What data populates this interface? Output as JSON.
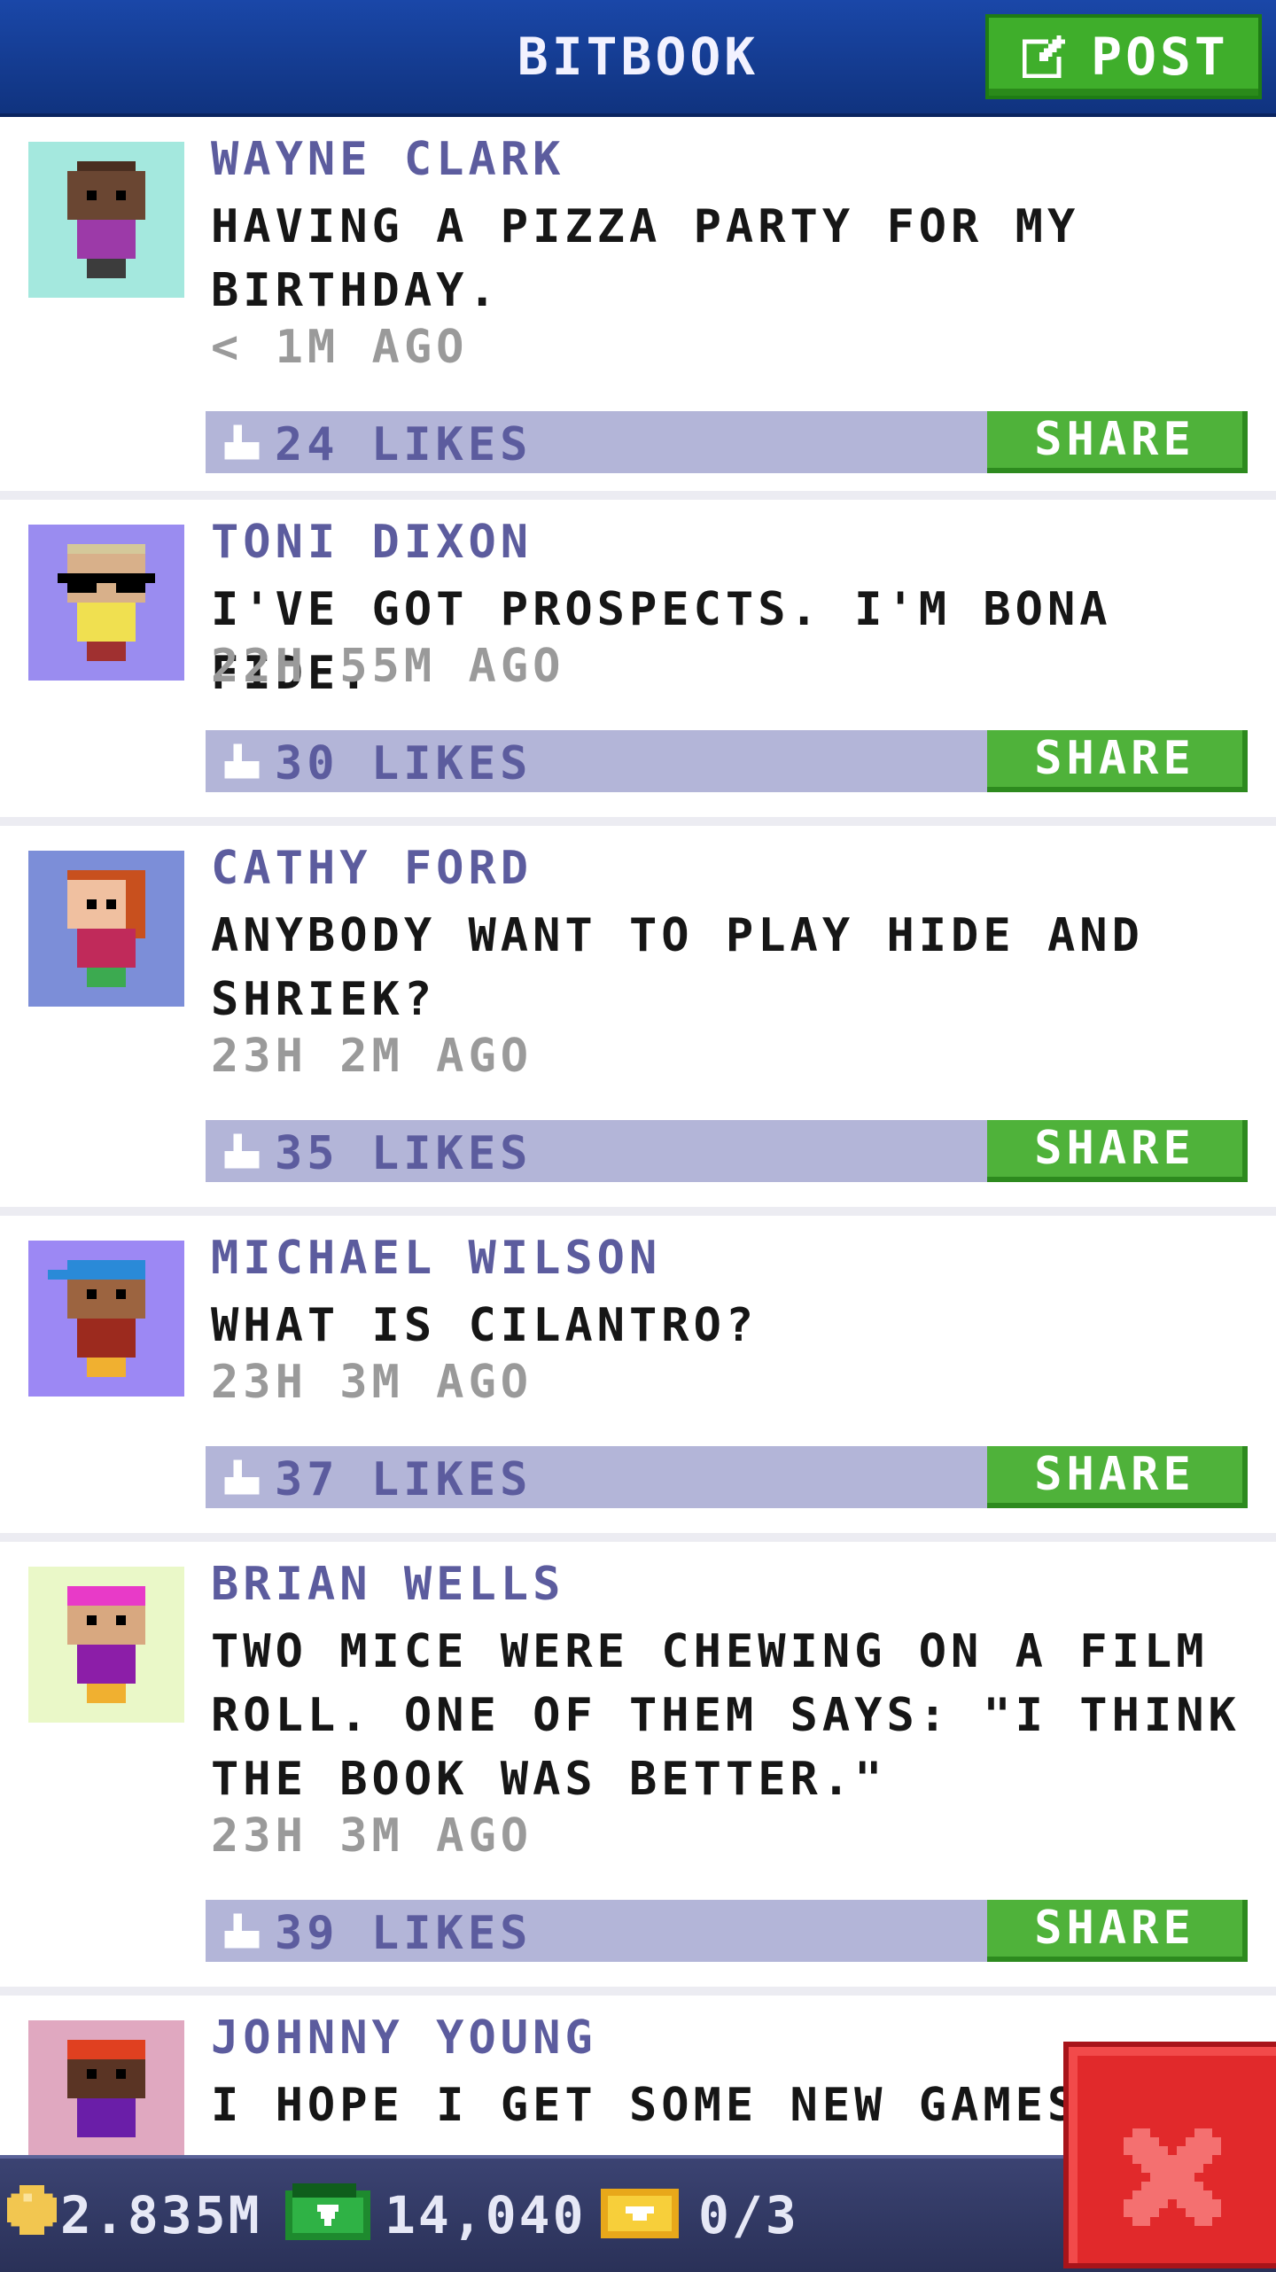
{
  "header": {
    "title": "BITBOOK",
    "post_label": "POST",
    "post_icon": "edit-icon",
    "bar_color": "#10337f",
    "button_color": "#3fae2b"
  },
  "posts": [
    {
      "author": "WAYNE CLARK",
      "message": "HAVING A PIZZA PARTY FOR MY BIRTHDAY.",
      "time": "< 1M AGO",
      "likes": "24 LIKES",
      "share_label": "SHARE",
      "avatar_bg": "#a4e8de",
      "avatar_skin": "#6a4632",
      "avatar_hair": "#4a2e20",
      "avatar_shirt": "#9c3aa8"
    },
    {
      "author": "TONI DIXON",
      "message": "I'VE GOT PROSPECTS. I'M BONA FIDE.",
      "time": "22H 55M AGO",
      "likes": "30 LIKES",
      "share_label": "SHARE",
      "avatar_bg": "#9a8cf0",
      "avatar_skin": "#d8b08a",
      "avatar_hair": "#d4c89a",
      "avatar_shirt": "#f0e050"
    },
    {
      "author": "CATHY FORD",
      "message": "ANYBODY WANT TO PLAY HIDE AND SHRIEK?",
      "time": "23H 2M AGO",
      "likes": "35 LIKES",
      "share_label": "SHARE",
      "avatar_bg": "#7c8ed8",
      "avatar_skin": "#f0c0a0",
      "avatar_hair": "#c8501e",
      "avatar_shirt": "#c02a5a"
    },
    {
      "author": "MICHAEL WILSON",
      "message": "WHAT IS CILANTRO?",
      "time": "23H 3M AGO",
      "likes": "37 LIKES",
      "share_label": "SHARE",
      "avatar_bg": "#9c88f4",
      "avatar_skin": "#9c6440",
      "avatar_hair": "#2a8ad8",
      "avatar_shirt": "#9c2a1e"
    },
    {
      "author": "BRIAN WELLS",
      "message": "TWO MICE WERE CHEWING ON A FILM ROLL. ONE OF THEM SAYS: \"I THINK THE BOOK WAS BETTER.\"",
      "time": "23H 3M AGO",
      "likes": "39 LIKES",
      "share_label": "SHARE",
      "avatar_bg": "#eaf8c8",
      "avatar_skin": "#d8a880",
      "avatar_hair": "#e83ac8",
      "avatar_shirt": "#8c1ea8"
    },
    {
      "author": "JOHNNY YOUNG",
      "message": "I HOPE I GET SOME NEW GAMES F",
      "time": "",
      "likes": "",
      "share_label": "",
      "avatar_bg": "#e0a8c0",
      "avatar_skin": "#5a3424",
      "avatar_hair": "#e04020",
      "avatar_shirt": "#6a1ea8"
    }
  ],
  "status": {
    "coins": "2.835M",
    "coins_icon": "coin-icon",
    "bux": "14,040",
    "bux_icon": "bux-icon",
    "tickets": "0/3",
    "tickets_icon": "ticket-icon"
  },
  "close": {
    "icon": "close-icon",
    "color": "#e1292b"
  }
}
